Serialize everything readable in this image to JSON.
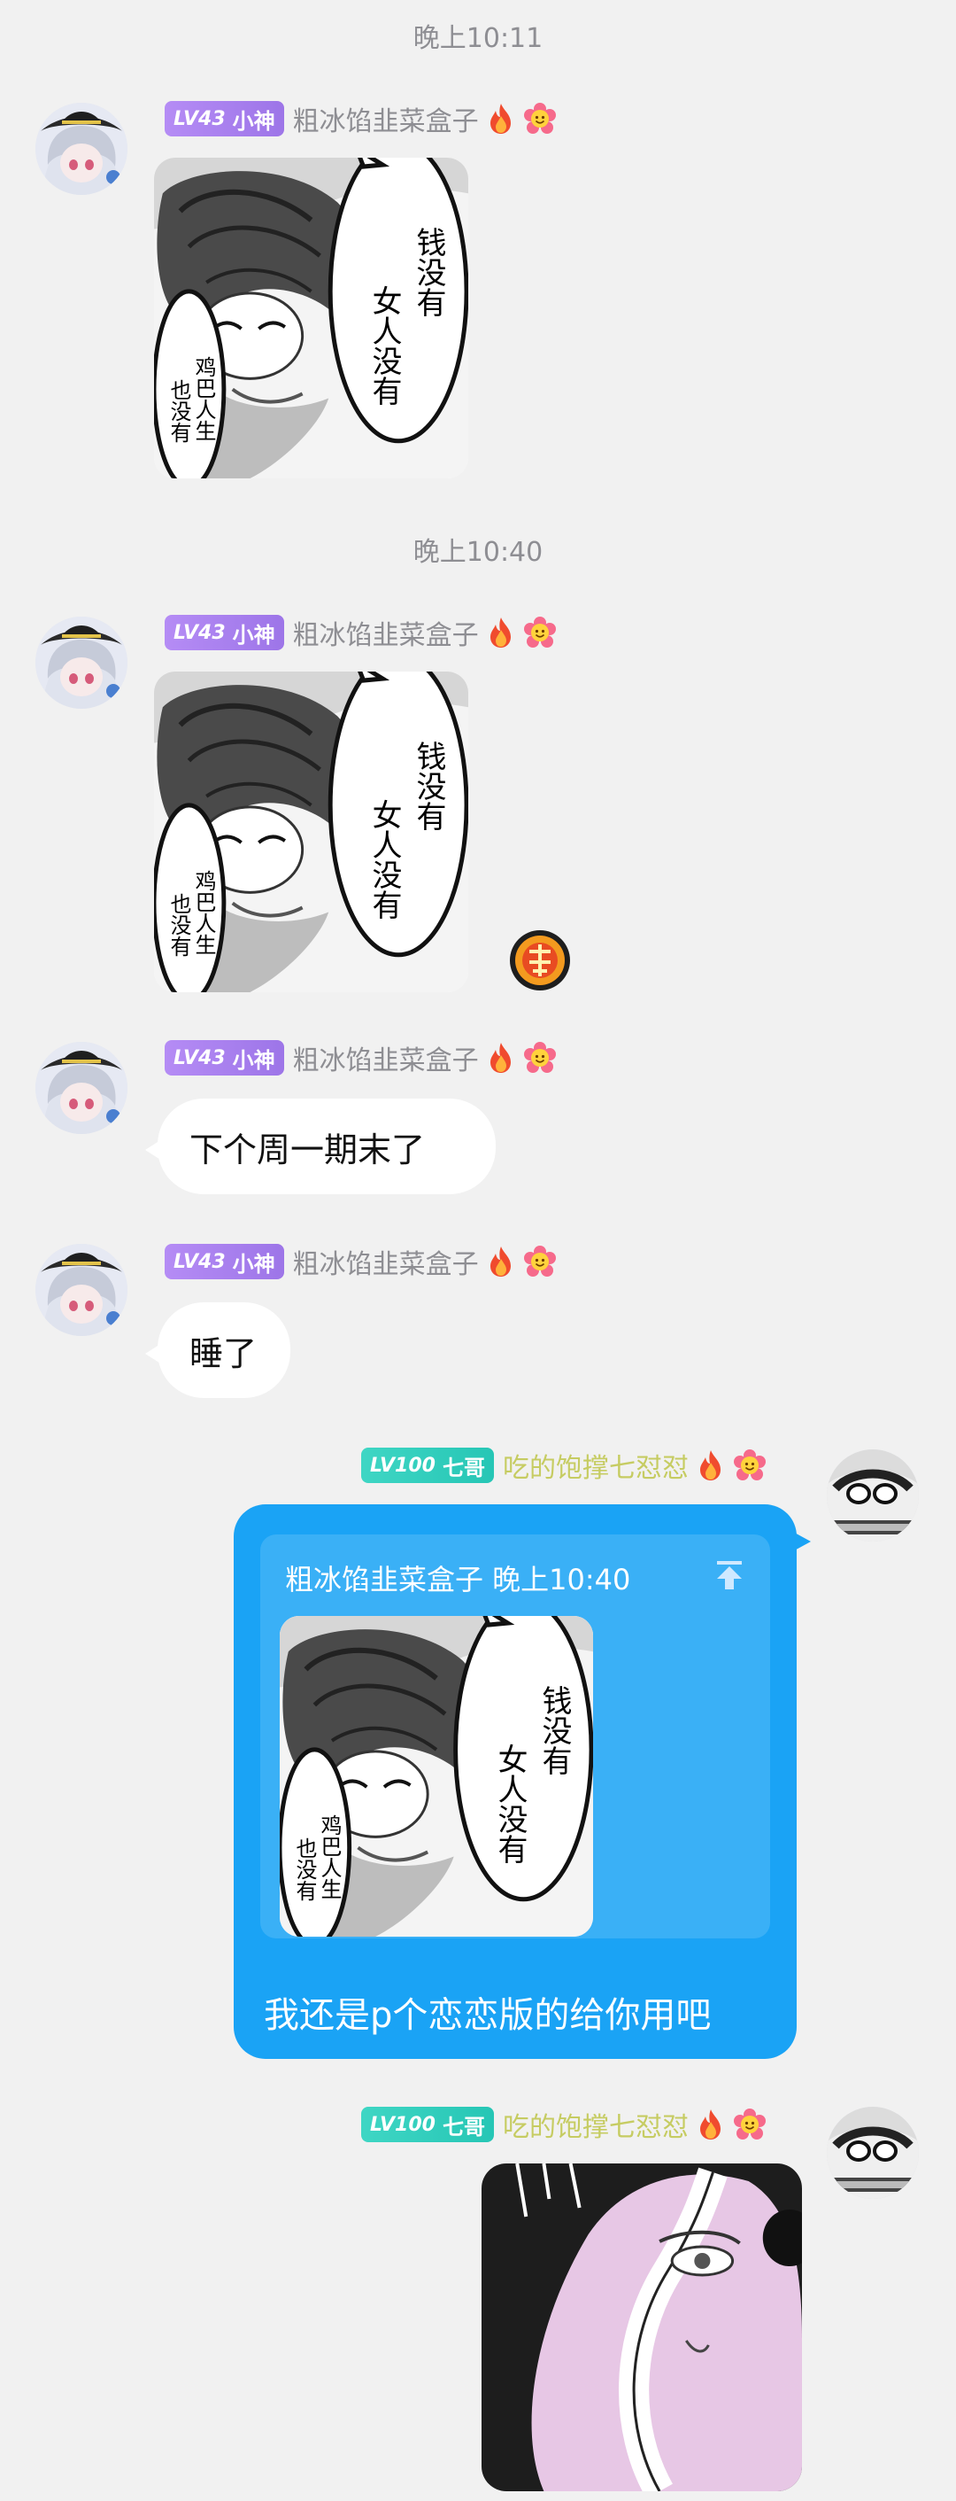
{
  "timestamps": [
    "晚上10:11",
    "晚上10:40"
  ],
  "users": {
    "friend": {
      "level": "LV43",
      "title": "小神",
      "nickname": "粗冰馅韭菜盒子"
    },
    "me": {
      "level": "LV100",
      "title": "七哥",
      "nickname": "吃的饱撑七怼怼"
    }
  },
  "meme": {
    "line1": "钱没有",
    "line2": "女人没有",
    "line3": "鸡巴人生",
    "line4": "也没有"
  },
  "messages": {
    "m3": "下个周一期末了",
    "m4": "睡了",
    "reply_quote_header": "粗冰馅韭菜盒子 晚上10:40",
    "reply_text": "我还是p个恋恋版的给你用吧"
  },
  "colors": {
    "bubble_blue": "#1aa3f5",
    "level_purple": "#a57ff0",
    "level_teal": "#2ec9b8",
    "time": "#8e8e93"
  },
  "icons": {
    "reaction": "dui-emoji-icon",
    "scroll_top": "arrow-up-to-line-icon",
    "flame": "flame-icon",
    "flower": "flower-icon"
  }
}
